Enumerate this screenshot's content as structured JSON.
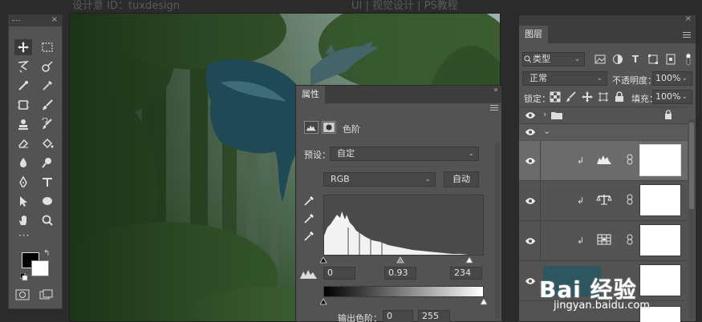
{
  "header": {
    "left_text": "设计意 ID：tuxdesign",
    "center_text": "UI | 视觉设计 | PS教程"
  },
  "tools": {
    "icons": [
      "move-icon",
      "marquee-icon",
      "lasso-icon",
      "quick-select-icon",
      "crop-icon",
      "eyedropper-icon",
      "frame-icon",
      "brush-icon",
      "stamp-icon",
      "history-brush-icon",
      "eraser-icon",
      "paint-bucket-icon",
      "blur-icon",
      "dodge-icon",
      "pen-icon",
      "type-icon",
      "path-select-icon",
      "shape-icon",
      "hand-icon",
      "zoom-icon"
    ],
    "more": "···",
    "foreground_color": "#000000",
    "background_color": "#ffffff"
  },
  "properties": {
    "tab_label": "属性",
    "adjustment_name": "色阶",
    "preset_label": "预设：",
    "preset_value": "自定",
    "channel_value": "RGB",
    "auto_button": "自动",
    "input_black": "0",
    "input_gamma": "0.93",
    "input_white": "234",
    "output_label": "输出色阶：",
    "output_black": "0",
    "output_white": "255"
  },
  "layers": {
    "tab_label": "图层",
    "filter_value": "类型",
    "blend_mode": "正常",
    "opacity_label": "不透明度：",
    "opacity_value": "100%",
    "lock_label": "锁定：",
    "fill_label": "填充：",
    "fill_value": "100%"
  },
  "watermark": {
    "brand": "Bai 经验",
    "url": "jingyan.baidu.com"
  },
  "colors": {
    "panel": "#535353",
    "dark": "#3d3d3d",
    "selected_row": "#6b6b6b"
  }
}
